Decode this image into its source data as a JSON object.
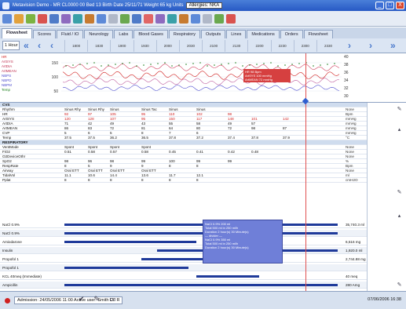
{
  "window": {
    "title": "Metavision Demo - MR CL0000 00 Bed 13 Birth Date 25/11/71 Weight 65 kg Units",
    "allergy": "Allergies: NKA",
    "minimize_label": "_",
    "maximize_label": "□",
    "close_label": "X"
  },
  "tabs": [
    {
      "label": "Flowsheet"
    },
    {
      "label": "Scores"
    },
    {
      "label": "Fluid / IO"
    },
    {
      "label": "Neurology"
    },
    {
      "label": "Labs"
    },
    {
      "label": "Blood Gases"
    },
    {
      "label": "Respiratory"
    },
    {
      "label": "Outputs"
    },
    {
      "label": "Lines"
    },
    {
      "label": "Medications"
    },
    {
      "label": "Orders"
    },
    {
      "label": "Flowsheet"
    }
  ],
  "timeline": {
    "period": "1 Hour",
    "times": [
      "1800",
      "1830",
      "1900",
      "1930",
      "2000",
      "2030",
      "2100",
      "2130",
      "2200",
      "2230",
      "2300",
      "2330"
    ]
  },
  "chart": {
    "legend": [
      "HR",
      "ArtSYS",
      "ArtDIA",
      "ArtMEAN",
      "NBPS",
      "NBPD",
      "NBPM",
      "Temp"
    ],
    "left_ticks": [
      "150",
      "100",
      "50"
    ],
    "right_ticks": [
      "40",
      "38",
      "36",
      "34",
      "32",
      "30"
    ],
    "tooltip": [
      "HR 98 Bpm",
      "ArtSYS 100 mmHg",
      "ArtMEAN 72 mmHg"
    ]
  },
  "grid": {
    "sections": [
      {
        "title": "CVS",
        "rows": [
          {
            "label": "Rhythm",
            "cells": [
              "Sinus Rhy",
              "Sinus Rhy",
              "Sinus",
              "Sinus Tac",
              "Sinus",
              "Sinus"
            ],
            "unit": "None"
          },
          {
            "label": "HR",
            "cells": [
              "92",
              "97",
              "105",
              "95",
              "110",
              "102",
              "98"
            ],
            "unit": "Bpm"
          },
          {
            "label": "ArtSYS",
            "cells": [
              "120",
              "128",
              "107",
              "95",
              "150",
              "117",
              "148",
              "101",
              "142"
            ],
            "unit": "mmHg"
          },
          {
            "label": "ArtDIA",
            "cells": [
              "71",
              "42",
              "49",
              "43",
              "55",
              "58",
              "49",
              "57"
            ],
            "unit": "mmHg"
          },
          {
            "label": "ArtMEAN",
            "cells": [
              "86",
              "83",
              "72",
              "81",
              "64",
              "80",
              "72",
              "98",
              "87"
            ],
            "unit": "mmHg"
          },
          {
            "label": "CVP",
            "cells": [
              "5",
              "6",
              "5",
              "8",
              "7",
              "6"
            ],
            "unit": "mmHg"
          },
          {
            "label": "Temp",
            "cells": [
              "37.5",
              "37.5",
              "36.2",
              "36.5",
              "37.8",
              "37.2",
              "37.4",
              "37.8",
              "37.9"
            ],
            "unit": "°C"
          }
        ]
      },
      {
        "title": "RESPIRATORY",
        "rows": [
          {
            "label": "VentMode",
            "cells": [
              "Spont",
              "Spont",
              "Spont",
              "Spont"
            ],
            "unit": "None"
          },
          {
            "label": "FiO2",
            "cells": [
              "0.51",
              "0.58",
              "0.57",
              "0.58",
              "0.45",
              "0.41",
              "0.42",
              "0.48"
            ],
            "unit": "None"
          },
          {
            "label": "O2DeviceOthr",
            "cells": [],
            "unit": "None"
          },
          {
            "label": "SpO2",
            "cells": [
              "98",
              "96",
              "98",
              "99",
              "100",
              "99",
              "99"
            ],
            "unit": "%"
          },
          {
            "label": "RespRate",
            "cells": [
              "8",
              "5",
              "9",
              "9",
              "8",
              "8"
            ],
            "unit": "Bpm"
          },
          {
            "label": "Airway",
            "cells": [
              "Oral ETT",
              "Oral ETT",
              "Oral ETT",
              "Oral ETT"
            ],
            "unit": "None"
          },
          {
            "label": "TidalVol",
            "cells": [
              "11.1",
              "10.6",
              "14.4",
              "13.6",
              "11.7",
              "12.1"
            ],
            "unit": "ml"
          },
          {
            "label": "Pplat",
            "cells": [
              "8",
              "8",
              "8",
              "8",
              "8",
              "8"
            ],
            "unit": "cmH2O"
          }
        ]
      }
    ]
  },
  "lanes": [
    {
      "label": "NaCl 0.9%",
      "unit": "35,740.3 ml"
    },
    {
      "label": "NaCl 0.9%",
      "unit": ""
    },
    {
      "label": "Amiodarone",
      "unit": "6,516 mg"
    },
    {
      "label": "Insulin",
      "unit": "1,920.0 ml"
    },
    {
      "label": "Propofol 1",
      "unit": "2,744.88 mg"
    },
    {
      "label": "Propofol 1",
      "unit": ""
    },
    {
      "label": "KCL 40meq (Immediate)",
      "unit": "40 meq"
    },
    {
      "label": "Ampicillin",
      "unit": "280 Amg"
    }
  ],
  "popup": [
    "NaCl 0.9% 200 ml",
    "Total 500 ml in 250 ml/h",
    "Duration 2 hour(s) 30 Minute(s)",
    "— divider —",
    "NaCl 0.9% 350 ml",
    "Total 500 ml in 250 ml/h",
    "Duration 2 hour(s) 30 Minute(s)"
  ],
  "status": {
    "admission": "Admission: 24/05/2006 11:00   Active user: Smith Dr. R",
    "datetime": "07/06/2006 16:38"
  },
  "colors": {
    "accent": "#2759c4",
    "alarm": "#d02020",
    "popup": "#6f7fd8"
  }
}
